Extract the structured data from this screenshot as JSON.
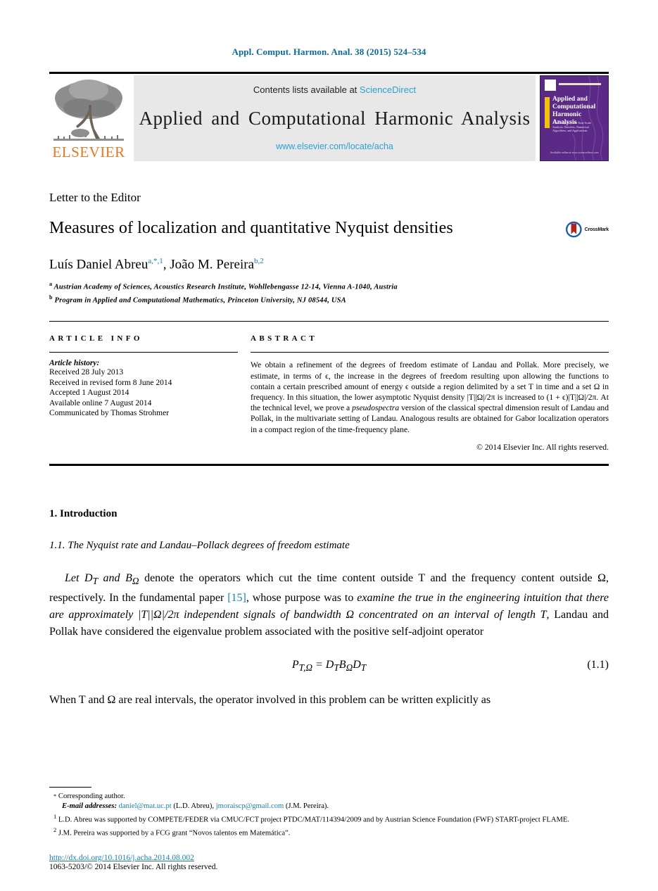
{
  "running_head": "Appl. Comput. Harmon. Anal. 38 (2015) 524–534",
  "masthead": {
    "publisher_name": "ELSEVIER",
    "contents_prefix": "Contents lists available at ",
    "contents_link": "ScienceDirect",
    "journal_title": "Applied and Computational Harmonic Analysis",
    "journal_url": "www.elsevier.com/locate/acha",
    "cover": {
      "title_line1": "Applied and",
      "title_line2": "Computational",
      "title_line3": "Harmonic Analysis",
      "subtitle": "Time-Frequency and Time-Scale Analysis, Wavelets, Numerical Algorithms, and Applications",
      "footer": "Available online at www.sciencedirect.com"
    },
    "colors": {
      "link_blue": "#2e9fd4",
      "elsevier_orange": "#E87722",
      "cover_purple": "#5b2a86"
    }
  },
  "article": {
    "kicker": "Letter to the Editor",
    "title": "Measures of localization and quantitative Nyquist densities",
    "crossmark_label": "CrossMark",
    "authors": [
      {
        "name": "Luís Daniel Abreu",
        "sup": "a,*,1"
      },
      {
        "name": "João M. Pereira",
        "sup": "b,2"
      }
    ],
    "affiliations": [
      {
        "marker": "a",
        "text": "Austrian Academy of Sciences, Acoustics Research Institute, Wohllebengasse 12-14, Vienna A-1040, Austria"
      },
      {
        "marker": "b",
        "text": "Program in Applied and Computational Mathematics, Princeton University, NJ 08544, USA"
      }
    ]
  },
  "article_info": {
    "label": "ARTICLE INFO",
    "history_label": "Article history:",
    "history": [
      "Received 28 July 2013",
      "Received in revised form 8 June 2014",
      "Accepted 1 August 2014",
      "Available online 7 August 2014",
      "Communicated by Thomas Strohmer"
    ]
  },
  "abstract": {
    "label": "ABSTRACT",
    "paragraph_1": "We obtain a refinement of the degrees of freedom estimate of Landau and Pollak. More precisely, we estimate, in terms of ϵ, the increase in the degrees of freedom resulting upon allowing the functions to contain a certain prescribed amount of energy ϵ outside a region delimited by a set T in time and a set Ω in frequency. In this situation, the lower asymptotic Nyquist density |T||Ω|/2π is increased to (1 + ϵ)|T||Ω|/2π. At the technical level, we prove a ",
    "emphasis": "pseudospectra",
    "paragraph_2": " version of the classical spectral dimension result of Landau and Pollak, in the multivariate setting of Landau. Analogous results are obtained for Gabor localization operators in a compact region of the time-frequency plane.",
    "copyright": "© 2014 Elsevier Inc. All rights reserved."
  },
  "body": {
    "section_1": "1. Introduction",
    "subsection_1_1": "1.1. The Nyquist rate and Landau–Pollack degrees of freedom estimate",
    "para_1_a": "Let D",
    "para_1_b": " and B",
    "para_1_c": " denote the operators which cut the time content outside T and the frequency content outside Ω, respectively. In the fundamental paper ",
    "para_1_ref": "[15]",
    "para_1_d": ", whose purpose was to ",
    "para_1_italic": "examine the true in the engineering intuition that there are approximately |T||Ω|/2π independent signals of bandwidth Ω concentrated on an interval of length T",
    "para_1_e": ", Landau and Pollak have considered the eigenvalue problem associated with the positive self-adjoint operator",
    "equation_1": "P",
    "equation_1_full": "P_{T,Ω} = D_T B_Ω D_T",
    "equation_1_number": "(1.1)",
    "para_2": "When T and Ω are real intervals, the operator involved in this problem can be written explicitly as"
  },
  "footnotes": {
    "corresponding": "Corresponding author.",
    "corresponding_marker": "*",
    "email_label": "E-mail addresses:",
    "email_1": "daniel@mat.uc.pt",
    "email_1_owner": "(L.D. Abreu),",
    "email_2": "jmoraiscp@gmail.com",
    "email_2_owner": "(J.M. Pereira).",
    "note_1_marker": "1",
    "note_1": "L.D. Abreu was supported by COMPETE/FEDER via CMUC/FCT project PTDC/MAT/114394/2009 and by Austrian Science Foundation (FWF) START-project FLAME.",
    "note_2_marker": "2",
    "note_2": "J.M. Pereira was supported by a FCG grant “Novos talentos em Matemática”."
  },
  "footer": {
    "doi": "http://dx.doi.org/10.1016/j.acha.2014.08.002",
    "issn_line": "1063-5203/© 2014 Elsevier Inc. All rights reserved."
  }
}
